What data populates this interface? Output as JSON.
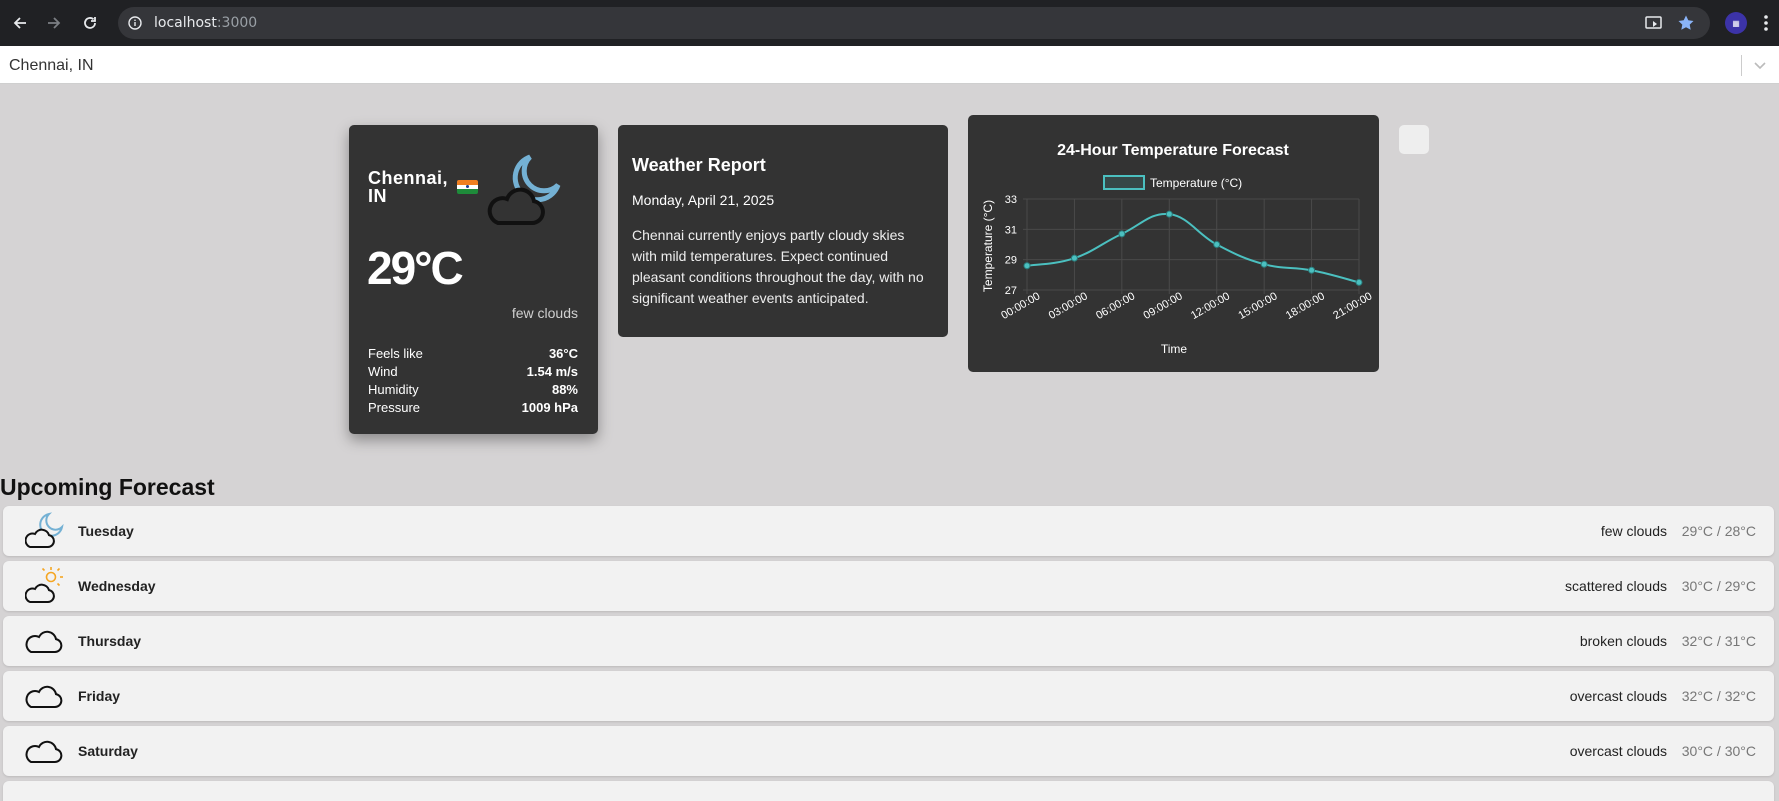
{
  "browser": {
    "url_host": "localhost",
    "url_port": ":3000"
  },
  "city_select": {
    "value": "Chennai, IN"
  },
  "current": {
    "city_line1": "Chennai,",
    "city_line2": "IN",
    "temperature": "29°C",
    "description": "few clouds",
    "icon": "night-few-clouds-icon",
    "details": [
      {
        "label": "Feels like",
        "value": "36°C"
      },
      {
        "label": "Wind",
        "value": "1.54 m/s"
      },
      {
        "label": "Humidity",
        "value": "88%"
      },
      {
        "label": "Pressure",
        "value": "1009 hPa"
      }
    ]
  },
  "report": {
    "title": "Weather Report",
    "date": "Monday, April 21, 2025",
    "text": "Chennai currently enjoys partly cloudy skies with mild temperatures. Expect continued pleasant conditions throughout the day, with no significant weather events anticipated."
  },
  "chart_data": {
    "type": "line",
    "title": "24-Hour Temperature Forecast",
    "xlabel": "Time",
    "ylabel": "Temperature (°C)",
    "categories": [
      "00:00:00",
      "03:00:00",
      "06:00:00",
      "09:00:00",
      "12:00:00",
      "15:00:00",
      "18:00:00",
      "21:00:00"
    ],
    "series": [
      {
        "name": "Temperature (°C)",
        "values": [
          28.6,
          29.1,
          30.7,
          32.0,
          30.0,
          28.7,
          28.3,
          27.5
        ],
        "color": "#4bc0c0"
      }
    ],
    "yticks": [
      "33",
      "31",
      "29",
      "27"
    ],
    "ylim": [
      27,
      33
    ],
    "grid": true,
    "legend": "top"
  },
  "forecast": {
    "heading": "Upcoming Forecast",
    "days": [
      {
        "day": "Tuesday",
        "description": "few clouds",
        "temps": "29°C / 28°C",
        "icon": "night-few-clouds-icon"
      },
      {
        "day": "Wednesday",
        "description": "scattered clouds",
        "temps": "30°C / 29°C",
        "icon": "sun-cloud-icon"
      },
      {
        "day": "Thursday",
        "description": "broken clouds",
        "temps": "32°C / 31°C",
        "icon": "cloud-icon"
      },
      {
        "day": "Friday",
        "description": "overcast clouds",
        "temps": "32°C / 32°C",
        "icon": "cloud-icon"
      },
      {
        "day": "Saturday",
        "description": "overcast clouds",
        "temps": "30°C / 30°C",
        "icon": "cloud-icon"
      }
    ]
  },
  "colors": {
    "card": "#333333",
    "page_bg": "#d5d3d4",
    "chart_line": "#4bc0c0",
    "moon": "#74b1d4",
    "sun": "#f5a623"
  }
}
